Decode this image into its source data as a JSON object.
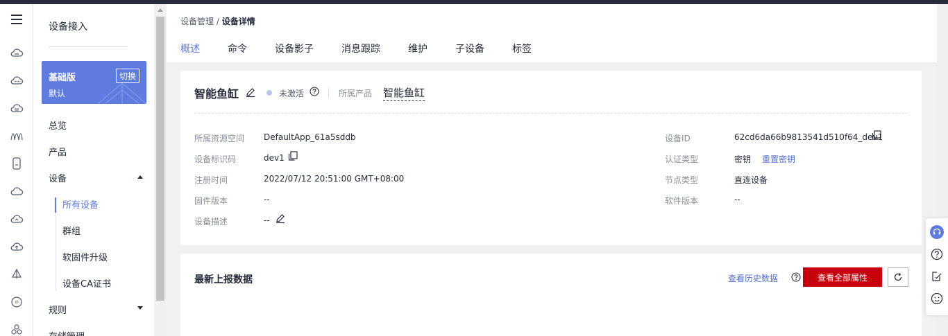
{
  "sidebar": {
    "title": "设备接入",
    "edition": {
      "name": "基础版",
      "sub": "默认",
      "switch_label": "切换"
    },
    "items": {
      "overview": "总览",
      "products": "产品",
      "devices": "设备",
      "all_devices": "所有设备",
      "groups": "群组",
      "firmware": "软固件升级",
      "ca_cert": "设备CA证书",
      "rules": "规则",
      "storage": "存储管理"
    }
  },
  "breadcrumb": {
    "parent": "设备管理",
    "separator": " / ",
    "current": "设备详情"
  },
  "tabs": [
    "概述",
    "命令",
    "设备影子",
    "消息跟踪",
    "维护",
    "子设备",
    "标签"
  ],
  "device": {
    "name": "智能鱼缸",
    "status": "未激活",
    "product_label": "所属产品",
    "product_name": "智能鱼缸"
  },
  "details": {
    "resource_space_label": "所属资源空间",
    "resource_space": "DefaultApp_61a5sddb",
    "identifier_label": "设备标识码",
    "identifier": "dev1",
    "reg_time_label": "注册时间",
    "reg_time": "2022/07/12 20:51:00 GMT+08:00",
    "firmware_label": "固件版本",
    "firmware": "--",
    "desc_label": "设备描述",
    "desc": "--",
    "device_id_label": "设备ID",
    "device_id": "62cd6da66b9813541d510f64_dev1",
    "auth_label": "认证类型",
    "auth": "密钥",
    "reset_key": "重置密钥",
    "node_label": "节点类型",
    "node": "直连设备",
    "software_label": "软件版本",
    "software": "--"
  },
  "report": {
    "title": "最新上报数据",
    "history_link": "查看历史数据",
    "view_all": "查看全部属性"
  },
  "colors": {
    "accent": "#5e7ce0",
    "primary_button": "#c7000b",
    "link": "#526ecc"
  }
}
